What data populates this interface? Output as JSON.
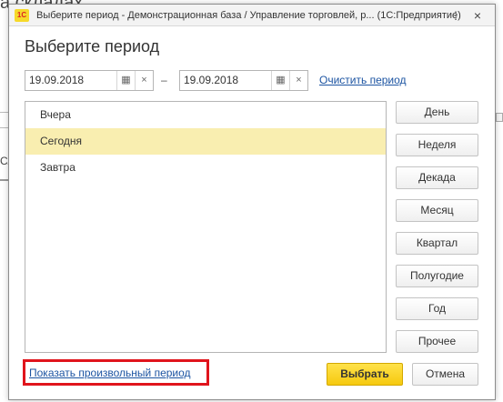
{
  "background": {
    "title_fragment": "а складах",
    "side_fragment": "Сл"
  },
  "window": {
    "logo": "1С",
    "title": "Выберите период - Демонстрационная база / Управление торговлей, р...  (1С:Предприятие)",
    "menu_icon": "⋮",
    "close_icon": "×"
  },
  "dialog": {
    "heading": "Выберите период",
    "date_from": "19.09.2018",
    "date_to": "19.09.2018",
    "dash": "–",
    "calendar_icon": "▦",
    "clear_icon": "×",
    "clear_link": "Очистить период",
    "list_items": [
      "Вчера",
      "Сегодня",
      "Завтра"
    ],
    "selected_item": "Сегодня",
    "period_buttons": [
      "День",
      "Неделя",
      "Декада",
      "Месяц",
      "Квартал",
      "Полугодие",
      "Год",
      "Прочее"
    ],
    "custom_link": "Показать произвольный период",
    "choose_label": "Выбрать",
    "cancel_label": "Отмена"
  },
  "colors": {
    "selected_row": "#f9eeb0",
    "link": "#1c54a2",
    "highlight_border": "#e0141c",
    "primary_button": "#f6c90e"
  }
}
